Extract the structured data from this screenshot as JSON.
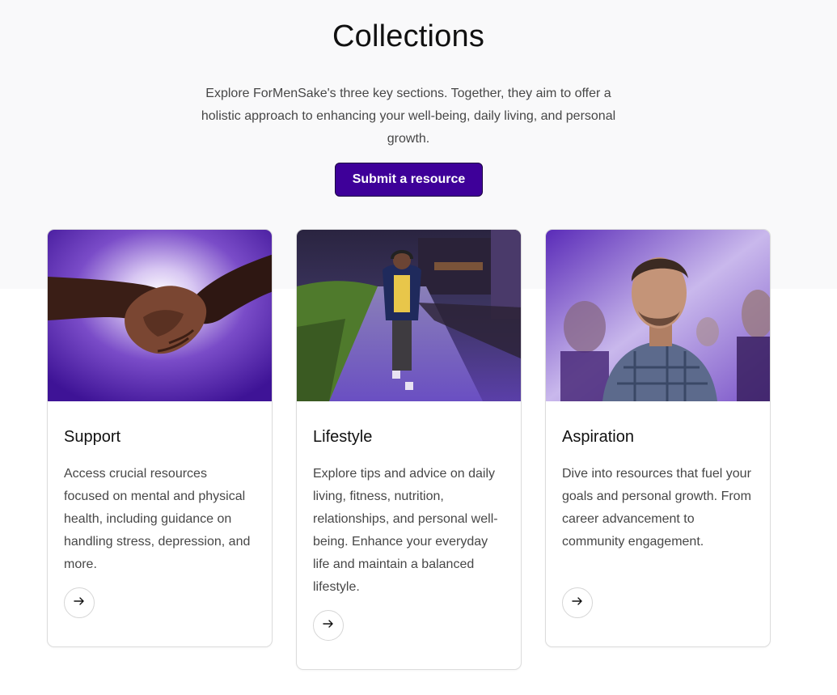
{
  "header": {
    "title": "Collections",
    "intro": "Explore ForMenSake's three key sections. Together, they aim to offer a holistic approach to enhancing your well-being, daily living, and personal growth.",
    "submit_label": "Submit a resource"
  },
  "colors": {
    "accent": "#3e0099",
    "text_muted": "#474747",
    "band": "#f9f9fa"
  },
  "cards": [
    {
      "title": "Support",
      "description": "Access crucial resources focused on mental and physical health, including guidance on handling stress, depression, and more.",
      "image": "handshake-photo",
      "arrow_icon": "arrow-right-icon"
    },
    {
      "title": "Lifestyle",
      "description": "Explore tips and advice on daily living, fitness, nutrition, relationships, and personal well-being. Enhance your everyday life and maintain a balanced lifestyle.",
      "image": "man-walking-photo",
      "arrow_icon": "arrow-right-icon"
    },
    {
      "title": "Aspiration",
      "description": "Dive into resources that fuel your goals and personal growth. From career advancement to community engagement.",
      "image": "man-looking-up-photo",
      "arrow_icon": "arrow-right-icon"
    }
  ]
}
